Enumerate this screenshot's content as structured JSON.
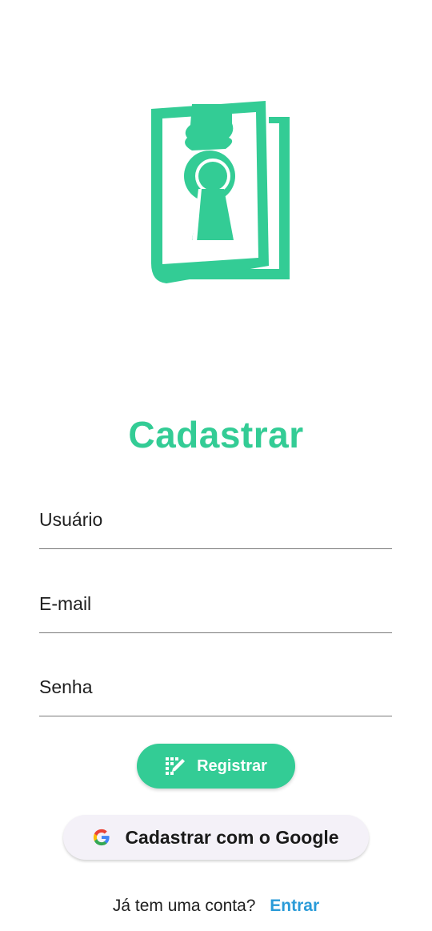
{
  "brand": {
    "accent_color": "#33cc95",
    "logo_icon": "book-keyhole-icon"
  },
  "page": {
    "title": "Cadastrar"
  },
  "form": {
    "username_placeholder": "Usuário",
    "email_placeholder": "E-mail",
    "password_placeholder": "Senha"
  },
  "actions": {
    "register_label": "Registrar",
    "register_icon": "register-icon",
    "google_label": "Cadastrar com o Google",
    "google_icon": "google-icon"
  },
  "footer": {
    "prompt": "Já tem uma conta?",
    "login_link": "Entrar",
    "link_color": "#2a9bd8"
  }
}
